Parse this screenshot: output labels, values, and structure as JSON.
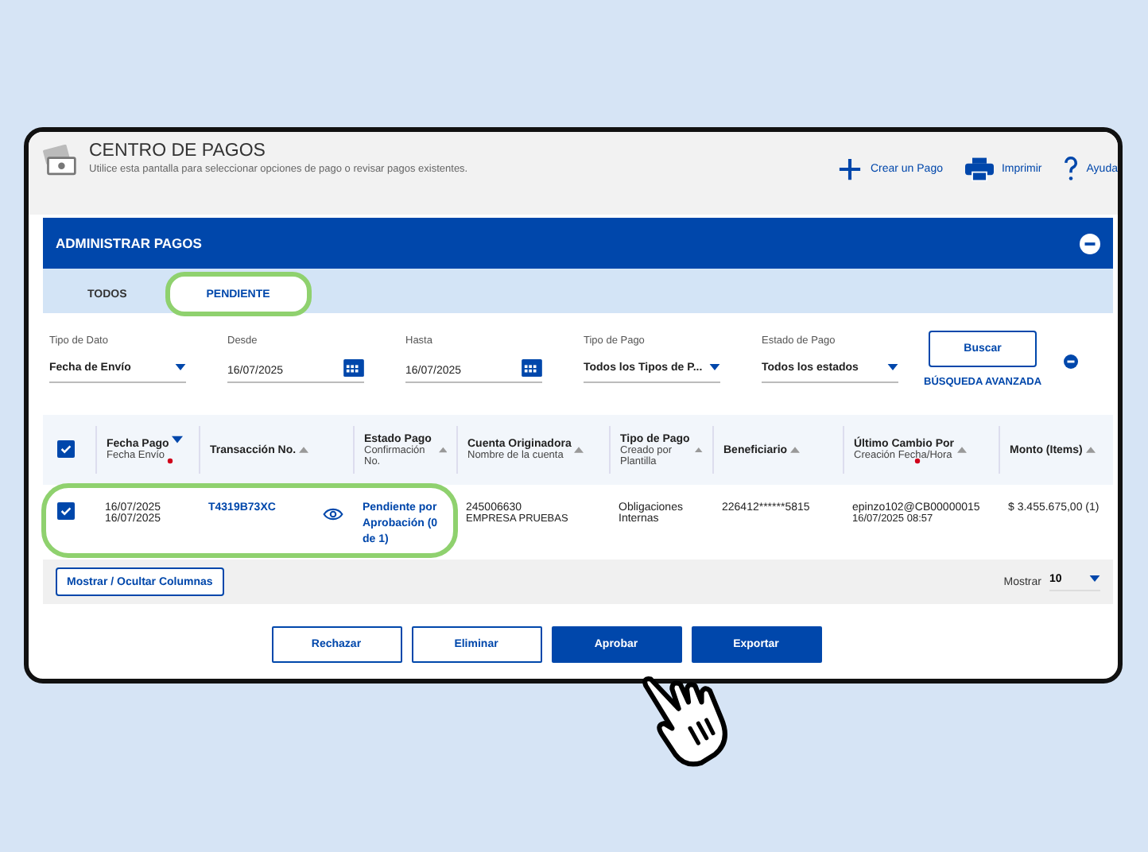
{
  "header": {
    "title": "CENTRO DE PAGOS",
    "subtitle": "Utilice esta pantalla para seleccionar opciones de pago o revisar pagos existentes.",
    "actions": [
      {
        "kind": "create",
        "label": "Crear un Pago"
      },
      {
        "kind": "print",
        "label": "Imprimir"
      },
      {
        "kind": "help",
        "label": "Ayuda"
      }
    ]
  },
  "panel": {
    "title": "ADMINISTRAR PAGOS"
  },
  "tabs": [
    {
      "label": "TODOS",
      "selected": false,
      "highlighted": false
    },
    {
      "label": "PENDIENTE",
      "selected": true,
      "highlighted": true
    }
  ],
  "filters": [
    {
      "kind": "select",
      "label": "Tipo de Dato",
      "value": "Fecha de Envío"
    },
    {
      "kind": "date",
      "label": "Desde",
      "value": "16/07/2025"
    },
    {
      "kind": "date",
      "label": "Hasta",
      "value": "16/07/2025"
    },
    {
      "kind": "select",
      "label": "Tipo de Pago",
      "value": "Todos los Tipos de P..."
    },
    {
      "kind": "select",
      "label": "Estado de Pago",
      "value": "Todos los estados"
    }
  ],
  "search_button": "Buscar",
  "advanced_search": "BÚSQUEDA AVANZADA",
  "table": {
    "all_checked": true,
    "columns": [
      {
        "title": "Fecha Pago",
        "subtitle": "Fecha Envío",
        "required": true,
        "descending": true
      },
      {
        "title": "Transacción No.",
        "descending": false
      },
      {
        "title": "Estado Pago",
        "subtitle": "Confirmación No.",
        "descending": false
      },
      {
        "title": "Cuenta Originadora",
        "subtitle": "Nombre de la cuenta",
        "descending": false
      },
      {
        "title": "Tipo de Pago",
        "subtitle": "Creado por Plantilla",
        "descending": false
      },
      {
        "title": "Beneficiario",
        "descending": false
      },
      {
        "title": "Último Cambio Por",
        "subtitle": "Creación Fecha/Hora",
        "required": true,
        "descending": false
      },
      {
        "title": "Monto (Items)",
        "descending": false
      }
    ],
    "rows": [
      {
        "checked": true,
        "highlighted": true,
        "payment_date": "16/07/2025",
        "send_date": "16/07/2025",
        "transaction": "T4319B73XC",
        "status": "Pendiente por Aprobación (0 de 1)",
        "account": "245006630",
        "account_name": "EMPRESA PRUEBAS",
        "payment_type": "Obligaciones Internas",
        "beneficiary": "226412******5815",
        "changed_by": "epinzo102@CB00000015",
        "created": "16/07/2025 08:57",
        "amount": "$ 3.455.675,00 (1)"
      }
    ]
  },
  "columns_button": "Mostrar / Ocultar Columnas",
  "page_size": {
    "label": "Mostrar",
    "value": "10"
  },
  "buttons": [
    {
      "label": "Rechazar",
      "kind": "outline"
    },
    {
      "label": "Eliminar",
      "kind": "outline"
    },
    {
      "label": "Aprobar",
      "kind": "primary"
    },
    {
      "label": "Exportar",
      "kind": "primary"
    }
  ]
}
